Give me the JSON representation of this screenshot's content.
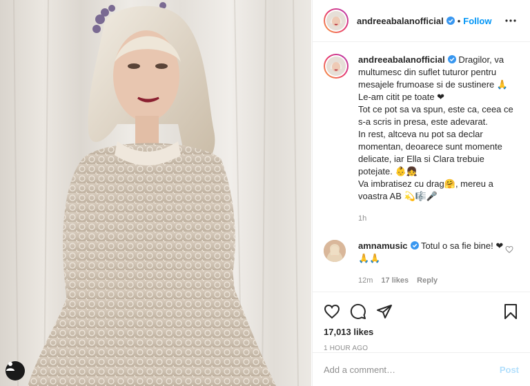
{
  "post": {
    "author": "andreeabalanofficial",
    "verified_icon": "verified-badge-icon",
    "follow_label": "Follow",
    "more_icon": "more-options-icon",
    "tag_icon": "user-tag-icon"
  },
  "caption": {
    "username": "andreeabalanofficial",
    "lines": [
      "Dragilor, va multumesc din suflet tuturor pentru mesajele frumoase si de sustinere 🙏",
      "Le-am citit pe toate ❤",
      "Tot ce pot sa va spun, este ca, ceea ce s-a scris in presa, este adevarat.",
      "In rest, altceva nu pot sa declar momentan, deoarece sunt momente delicate, iar Ella si Clara trebuie potejate. 👶👧",
      "Va imbratisez cu drag🤗, mereu a voastra AB 💫🎼🎤"
    ],
    "time": "1h"
  },
  "comments": [
    {
      "username": "amnamusic",
      "text": "Totul o sa fie bine! ❤🙏🙏",
      "time": "12m",
      "likes": "17 likes",
      "reply": "Reply"
    }
  ],
  "actions": {
    "icons": [
      "heart-icon",
      "comment-icon",
      "share-icon",
      "bookmark-icon"
    ],
    "likes": "17,013 likes",
    "time_ago": "1 HOUR AGO"
  },
  "add_comment": {
    "placeholder": "Add a comment…",
    "post_label": "Post"
  },
  "colors": {
    "accent": "#0095f6",
    "post_disabled": "#b2dffc",
    "muted": "#8e8e8e",
    "text": "#262626"
  }
}
